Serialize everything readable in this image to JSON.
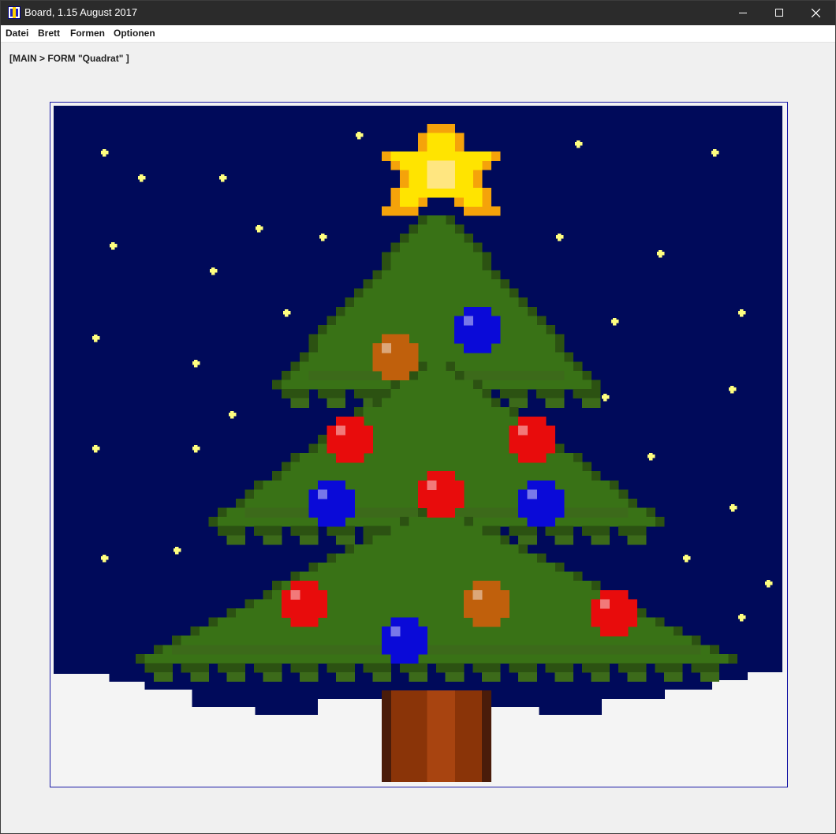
{
  "window": {
    "title": "Board, 1.15 August 2017",
    "icon": "board-app-icon",
    "controls": [
      "minimize-icon",
      "maximize-icon",
      "close-icon"
    ]
  },
  "menu": {
    "items": [
      "Datei",
      "Brett",
      "Formen",
      "Optionen"
    ]
  },
  "status": {
    "breadcrumb": "[MAIN > FORM \"Quadrat\" ]"
  },
  "board": {
    "grid_columns": 80,
    "grid_rows": 74,
    "colors": {
      "sky": "#000a5a",
      "snow": "#f4f4f4",
      "star_small": "#ffff80",
      "tree_dark": "#2c5212",
      "tree_mid": "#3c6a1a",
      "tree_main": "#397216",
      "trunk_dark": "#4a1c0a",
      "trunk": "#8a3408",
      "trunk_light": "#a84410",
      "star_outer": "#f5a30a",
      "star_inner": "#ffe400",
      "star_highlight": "#ffe680",
      "ornament_blue": "#0a0ad8",
      "ornament_red": "#e80c0c",
      "ornament_orange": "#c0600c"
    }
  }
}
